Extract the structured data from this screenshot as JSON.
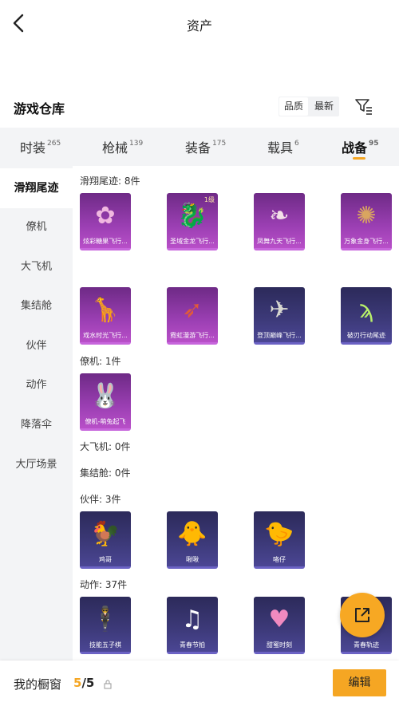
{
  "header": {
    "title": "资产",
    "back_icon": "chevron-left-icon"
  },
  "warehouse": {
    "title": "游戏仓库",
    "sort_options": [
      "品质",
      "最新"
    ],
    "filter_icon": "filter-icon"
  },
  "tabs": [
    {
      "label": "时装",
      "count": "265"
    },
    {
      "label": "枪械",
      "count": "139"
    },
    {
      "label": "装备",
      "count": "175"
    },
    {
      "label": "载具",
      "count": "6"
    },
    {
      "label": "战备",
      "count": "95"
    }
  ],
  "active_tab": "战备",
  "sidebar": [
    {
      "label": "滑翔尾迹"
    },
    {
      "label": "僚机"
    },
    {
      "label": "大飞机"
    },
    {
      "label": "集结舱"
    },
    {
      "label": "伙伴"
    },
    {
      "label": "动作"
    },
    {
      "label": "降落伞"
    },
    {
      "label": "大厅场景"
    }
  ],
  "sections": [
    {
      "title": "滑翔尾迹: 8件",
      "items": [
        {
          "name": "炫彩糖果飞行...",
          "style": "purple",
          "glyph": "✿",
          "glyph_color": "#f0b8e0"
        },
        {
          "name": "圣域金龙飞行...",
          "style": "purple",
          "glyph": "🐉",
          "level": "1级",
          "glyph_color": "#e0a84a"
        },
        {
          "name": "凤舞九天飞行...",
          "style": "purple",
          "glyph": "❧",
          "glyph_color": "#f3e0e8"
        },
        {
          "name": "万象金身飞行...",
          "style": "purple",
          "glyph": "✺",
          "glyph_color": "#d9a560"
        },
        {
          "name": "戏水时光飞行...",
          "style": "purple",
          "glyph": "🦒",
          "glyph_color": "#e3a33e"
        },
        {
          "name": "霓虹漫游飞行...",
          "style": "purple",
          "glyph": "➶",
          "glyph_color": "#e05a3a"
        },
        {
          "name": "登顶巅峰飞行...",
          "style": "dark",
          "glyph": "✈",
          "glyph_color": "#d8d8d0"
        },
        {
          "name": "破刃行动尾迹",
          "style": "dark",
          "glyph": "ϡ",
          "glyph_color": "#b8f06a"
        }
      ]
    },
    {
      "title": "僚机: 1件",
      "items": [
        {
          "name": "僚机-萌兔起飞",
          "style": "purple",
          "glyph": "🐰",
          "glyph_color": "#f6c4d8"
        }
      ]
    },
    {
      "title": "大飞机: 0件",
      "items": []
    },
    {
      "title": "集结舱: 0件",
      "items": []
    },
    {
      "title": "伙伴: 3件",
      "items": [
        {
          "name": "鸡哥",
          "style": "dark",
          "glyph": "🐓",
          "glyph_color": "#e0a040"
        },
        {
          "name": "啾啾",
          "style": "dark",
          "glyph": "🐥",
          "glyph_color": "#f0b0b0"
        },
        {
          "name": "咯仔",
          "style": "dark",
          "glyph": "🐤",
          "glyph_color": "#d9a04a"
        }
      ]
    },
    {
      "title": "动作: 37件",
      "items": [
        {
          "name": "技能五子棋",
          "style": "dark",
          "glyph": "🕴",
          "glyph_color": "#ffffff"
        },
        {
          "name": "青春节拍",
          "style": "dark",
          "glyph": "♫",
          "glyph_color": "#ffffff"
        },
        {
          "name": "甜蜜时刻",
          "style": "dark",
          "glyph": "♥",
          "glyph_color": "#f08ac0"
        },
        {
          "name": "青春轨迹",
          "style": "dark",
          "glyph": "🤸",
          "glyph_color": "#ffffff"
        }
      ]
    }
  ],
  "fab": {
    "icon": "share-external-icon",
    "color": "#f7a823"
  },
  "bottom_bar": {
    "label": "我的橱窗",
    "current": "5",
    "separator": "/",
    "total": "5",
    "lock_icon": "lock-icon",
    "edit_label": "编辑"
  },
  "colors": {
    "accent": "#f5a623",
    "rare_purple": "#9b3fb3",
    "epic_indigo": "#3d3a7a"
  }
}
